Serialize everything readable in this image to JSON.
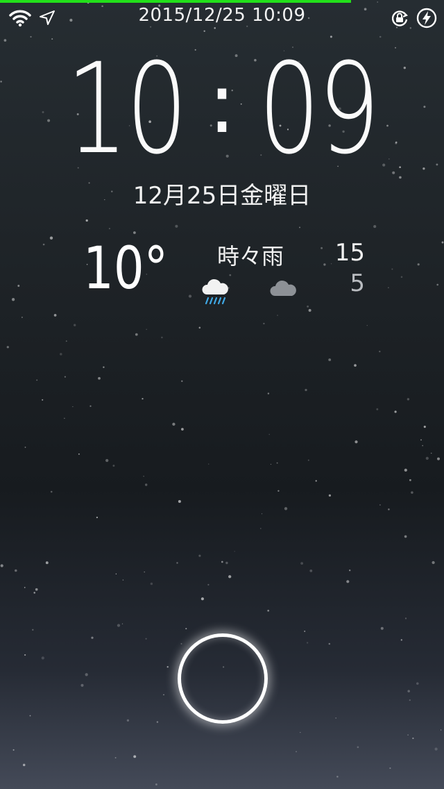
{
  "battery": {
    "level_percent": 79,
    "color": "#22e01a"
  },
  "status_bar": {
    "datetime": "2015/12/25 10:09",
    "icons": [
      "wifi-icon",
      "location-arrow-icon",
      "rotation-lock-icon",
      "charging-bolt-icon"
    ]
  },
  "clock": {
    "hours": "10",
    "separator": ":",
    "minutes": "09"
  },
  "date": "12月25日金曜日",
  "weather": {
    "current_temp": "10°",
    "condition": "時々雨",
    "high": "15",
    "low": "5",
    "icons": [
      "rain-cloud-icon",
      "cloud-icon"
    ]
  },
  "unlock": {
    "icon": "unlock-ring"
  }
}
